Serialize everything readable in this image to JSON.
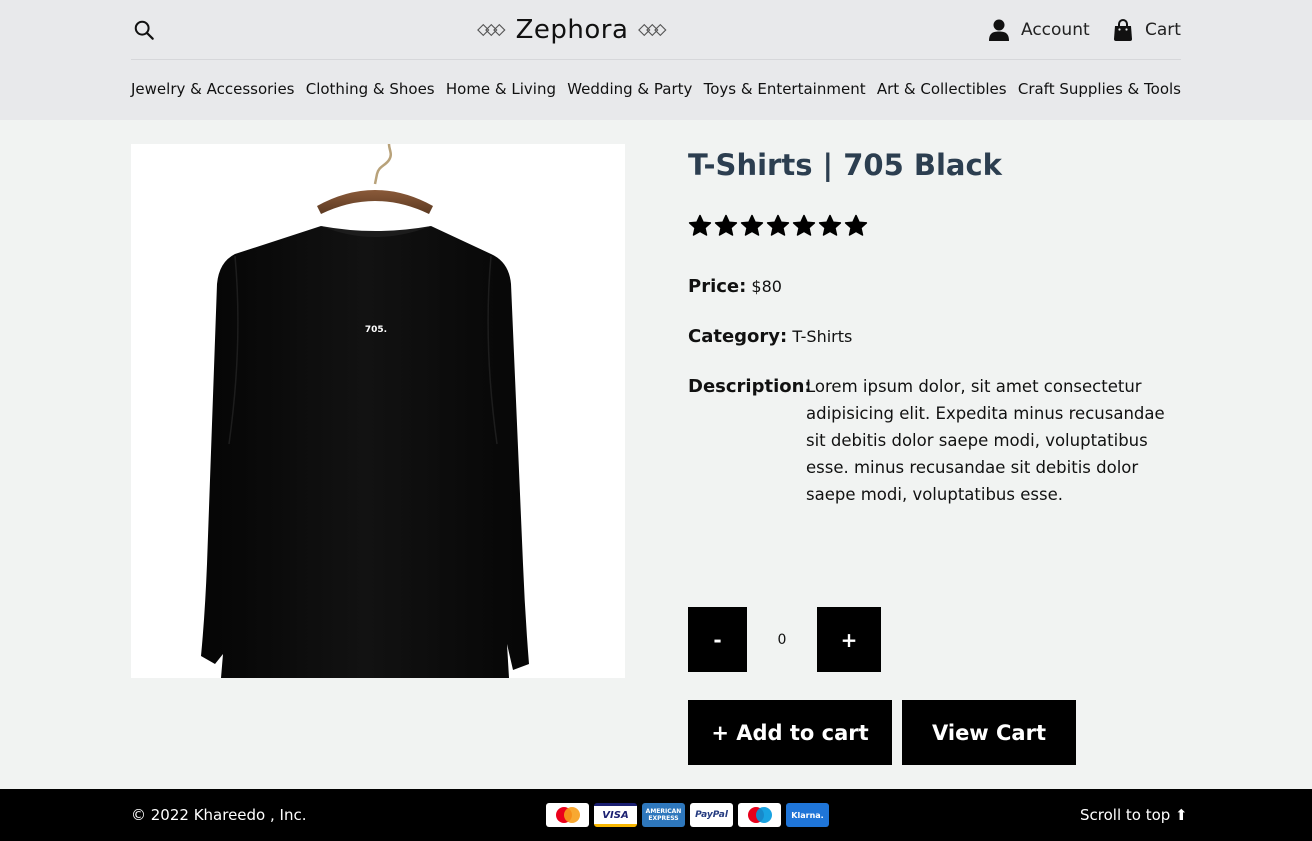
{
  "header": {
    "brand": "Zephora",
    "account_label": "Account",
    "cart_label": "Cart"
  },
  "nav": {
    "items": [
      {
        "label": "Jewelry & Accessories"
      },
      {
        "label": "Clothing & Shoes"
      },
      {
        "label": "Home & Living"
      },
      {
        "label": "Wedding & Party"
      },
      {
        "label": "Toys & Entertainment"
      },
      {
        "label": "Art & Collectibles"
      },
      {
        "label": "Craft Supplies & Tools"
      }
    ]
  },
  "product": {
    "title": "T-Shirts | 705 Black",
    "image_print": "705.",
    "rating": 7,
    "price_label": "Price:",
    "price": "$80",
    "category_label": "Category:",
    "category": "T-Shirts",
    "description_label": "Description:",
    "description": "Lorem ipsum dolor, sit amet consectetur adipisicing elit. Expedita minus recusandae sit debitis dolor saepe modi, voluptatibus esse. minus recusandae sit debitis dolor saepe modi, voluptatibus esse.",
    "quantity": "0",
    "minus_label": "-",
    "plus_label": "+",
    "add_to_cart_label": "+ Add to cart",
    "view_cart_label": "View Cart"
  },
  "footer": {
    "copyright": "© 2022 Khareedo , Inc.",
    "payment_methods": [
      {
        "name": "mastercard-icon",
        "label": ""
      },
      {
        "name": "visa-icon",
        "label": "VISA"
      },
      {
        "name": "amex-icon",
        "label": "AMERICAN EXPRESS"
      },
      {
        "name": "paypal-icon",
        "label": "PayPal"
      },
      {
        "name": "maestro-icon",
        "label": ""
      },
      {
        "name": "klarna-icon",
        "label": "Klarna."
      }
    ],
    "scroll_top_label": "Scroll to top ⬆"
  },
  "colors": {
    "title": "#2c3e50",
    "header_bg": "#e8e9eb",
    "page_bg": "#f1f3f2",
    "button_bg": "#000000"
  }
}
